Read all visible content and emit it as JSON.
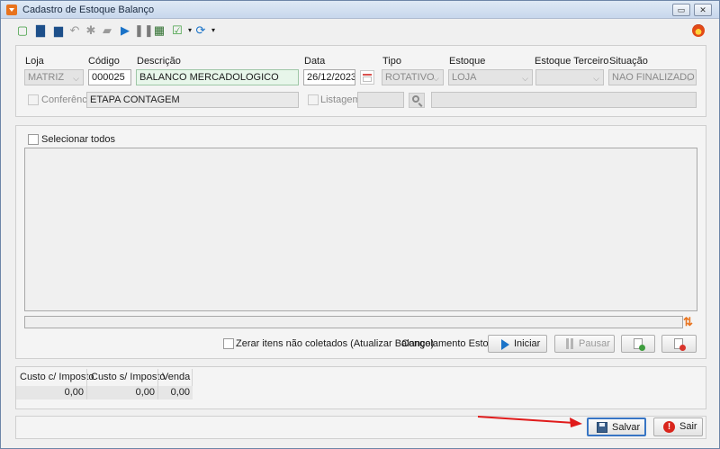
{
  "window": {
    "title": "Cadastro de Estoque Balanço",
    "minimize_label": "▭",
    "close_label": "✕"
  },
  "form": {
    "loja_label": "Loja",
    "loja_value": "MATRIZ",
    "codigo_label": "Código",
    "codigo_value": "000025",
    "descricao_label": "Descrição",
    "descricao_value": "BALANCO MERCADOLOGICO",
    "data_label": "Data",
    "data_value": "26/12/2023",
    "tipo_label": "Tipo",
    "tipo_value": "ROTATIVO",
    "estoque_label": "Estoque",
    "estoque_value": "LOJA",
    "estoque_terceiro_label": "Estoque Terceiro",
    "estoque_terceiro_value": "",
    "situacao_label": "Situação",
    "situacao_value": "NAO FINALIZADO",
    "conferencia_label": "Conferência",
    "etapa_value": "ETAPA CONTAGEM",
    "listagem_label": "Listagem"
  },
  "list": {
    "select_all_label": "Selecionar todos",
    "zerar_label": "Zerar itens não coletados (Atualizar Balanço)",
    "congelamento_label": "Congelamento Estoque",
    "iniciar_label": "Iniciar",
    "pausar_label": "Pausar"
  },
  "costs": {
    "headers": [
      "Custo c/ Imposto",
      "Custo s/ Imposto",
      "Venda"
    ],
    "values": [
      "0,00",
      "0,00",
      "0,00"
    ]
  },
  "footer": {
    "salvar_label": "Salvar",
    "sair_label": "Sair"
  },
  "colors": {
    "accent_orange": "#e8731e",
    "arrow_red": "#e01b1b",
    "play_blue": "#1a73c8"
  }
}
